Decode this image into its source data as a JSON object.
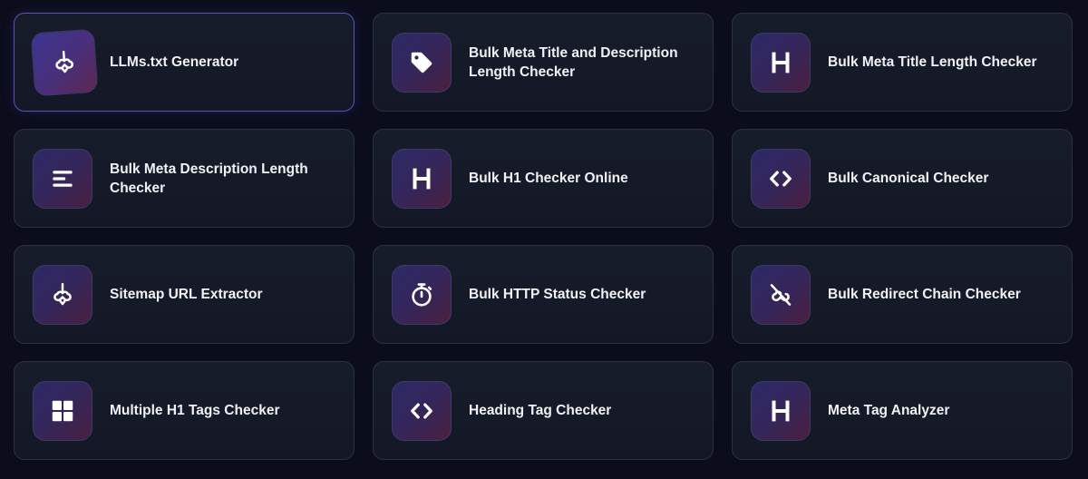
{
  "colors": {
    "background": "#0b0d1c",
    "card": "#161a28",
    "card_border": "#2a3142",
    "active_border": "#5a53b8",
    "icon_gradient_start": "#2b2a66",
    "icon_gradient_end": "#4a2040",
    "text": "#f1f2f7"
  },
  "tools": [
    {
      "label": "LLMs.txt Generator",
      "icon": "cloud-hook-icon",
      "active": true
    },
    {
      "label": "Bulk Meta Title and Description Length Checker",
      "icon": "tag-icon",
      "active": false
    },
    {
      "label": "Bulk Meta Title Length Checker",
      "icon": "heading-icon",
      "active": false
    },
    {
      "label": "Bulk Meta Description Length Checker",
      "icon": "lines-icon",
      "active": false
    },
    {
      "label": "Bulk H1 Checker Online",
      "icon": "heading-icon",
      "active": false
    },
    {
      "label": "Bulk Canonical Checker",
      "icon": "code-brackets-icon",
      "active": false
    },
    {
      "label": "Sitemap URL Extractor",
      "icon": "cloud-hook-icon",
      "active": false
    },
    {
      "label": "Bulk HTTP Status Checker",
      "icon": "stopwatch-icon",
      "active": false
    },
    {
      "label": "Bulk Redirect Chain Checker",
      "icon": "cloud-slash-icon",
      "active": false
    },
    {
      "label": "Multiple H1 Tags Checker",
      "icon": "grid-icon",
      "active": false
    },
    {
      "label": "Heading Tag Checker",
      "icon": "code-brackets-icon",
      "active": false
    },
    {
      "label": "Meta Tag Analyzer",
      "icon": "heading-icon",
      "active": false
    }
  ]
}
